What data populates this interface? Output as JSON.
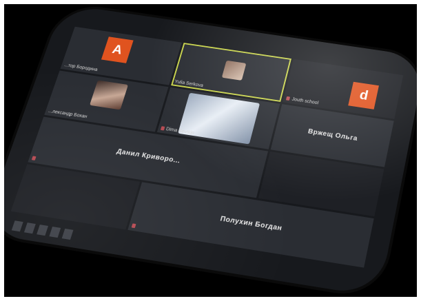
{
  "participants": {
    "top_left": {
      "name": "...тор Бородина",
      "avatar_letter": "A",
      "avatar_color": "#e0531f"
    },
    "top_center": {
      "name": "Yulia Serkova"
    },
    "top_right": {
      "name": "Jouth school",
      "avatar_letter": "d",
      "avatar_color": "#e0531f"
    },
    "mid_left": {
      "name": "...лександр Бохан"
    },
    "mid_center": {
      "name": "Dima Sevtkin"
    },
    "mid_right": {
      "name": "Вржещ Ольга"
    },
    "bottom_left": {
      "name": "Данил Криворо..."
    },
    "bottom_center": {
      "name": "Полухин Богдан"
    }
  },
  "colors": {
    "active_speaker_border": "#c9d44a",
    "avatar_orange": "#e0531f",
    "mic_muted": "#b64a52"
  }
}
